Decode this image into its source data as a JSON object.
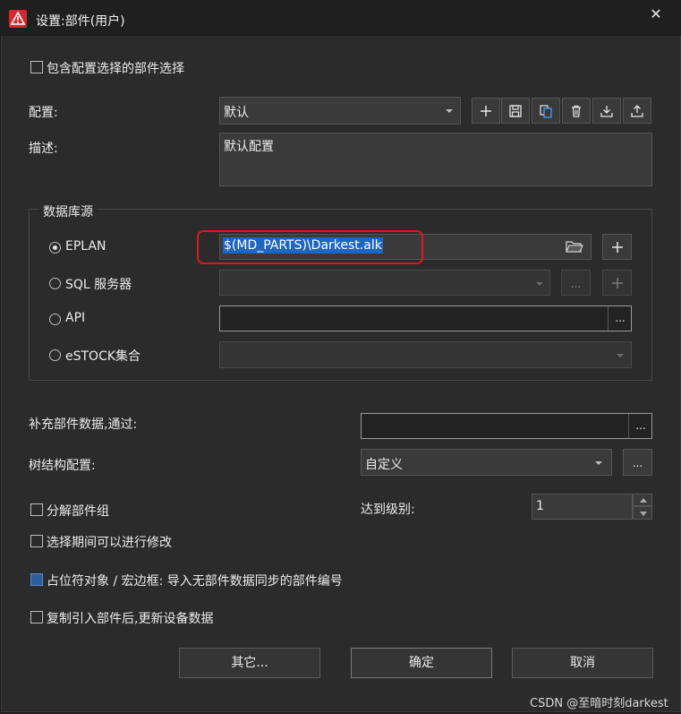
{
  "window": {
    "title": "设置:部件(用户)"
  },
  "include_config_checkbox": {
    "label": "包含配置选择的部件选择",
    "checked": false
  },
  "config": {
    "label": "配置:",
    "value": "默认",
    "toolbar_icons": [
      "plus-icon",
      "save-icon",
      "copy-icon",
      "trash-icon",
      "import-icon",
      "export-icon"
    ]
  },
  "description": {
    "label": "描述:",
    "value": "默认配置"
  },
  "database": {
    "group_title": "数据库源",
    "eplan": {
      "label": "EPLAN",
      "selected": true,
      "path": "$(MD_PARTS)\\Darkest.alk"
    },
    "sql": {
      "label": "SQL 服务器",
      "selected": false,
      "browse_label": "..."
    },
    "api": {
      "label": "API",
      "selected": false,
      "browse_label": "..."
    },
    "estock": {
      "label": "eSTOCK集合",
      "selected": false
    }
  },
  "supplement": {
    "label": "补充部件数据,通过:",
    "value": "",
    "browse_label": "..."
  },
  "tree": {
    "label": "树结构配置:",
    "value": "自定义",
    "more_label": "..."
  },
  "decompose": {
    "label": "分解部件组",
    "checked": false
  },
  "level": {
    "label": "达到级别:",
    "value": "1"
  },
  "modify": {
    "label": "选择期间可以进行修改",
    "checked": false
  },
  "placeholder": {
    "label": "占位符对象 / 宏边框: 导入无部件数据同步的部件编号",
    "checked": true
  },
  "copy_update": {
    "label": "复制引入部件后,更新设备数据",
    "checked": false
  },
  "buttons": {
    "other": "其它...",
    "ok": "确定",
    "cancel": "取消"
  },
  "watermark": "CSDN @至暗时刻darkest",
  "colors": {
    "selection": "#1c66c6",
    "highlight_box": "#e0171c",
    "checkbox_checked": "#2d5d9a"
  }
}
